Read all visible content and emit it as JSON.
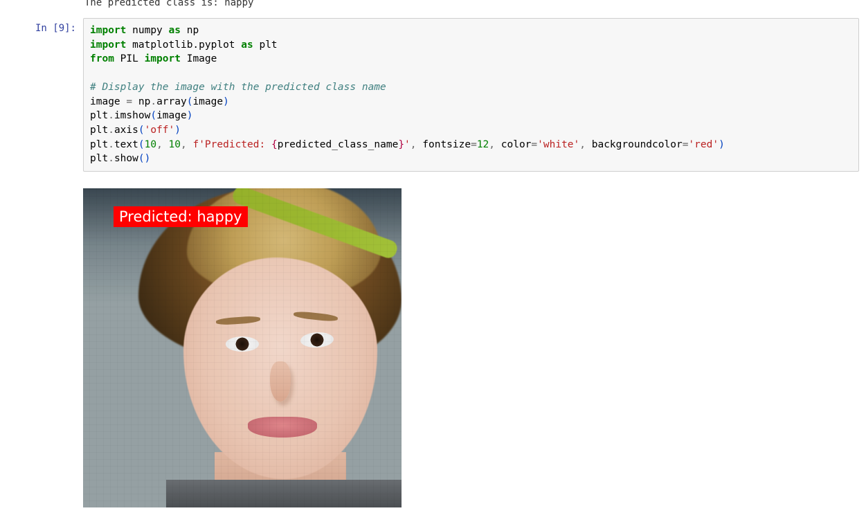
{
  "prev_output": {
    "text": "The predicted class is: happy"
  },
  "cell": {
    "prompt_label": "In [9]:"
  },
  "code": {
    "line1_import": "import",
    "line1_np": "numpy",
    "line1_as": "as",
    "line1_alias": "np",
    "line2_import": "import",
    "line2_mpl": "matplotlib.pyplot",
    "line2_as": "as",
    "line2_alias": "plt",
    "line3_from": "from",
    "line3_pil": "PIL",
    "line3_import": "import",
    "line3_image": "Image",
    "comment": "# Display the image with the predicted class name",
    "l5_lhs": "image",
    "l5_np": " np",
    "l5_dot": ".",
    "l5_array": "array",
    "l5_arg": "image",
    "l6_plt": "plt",
    "l6_imshow": "imshow",
    "l6_arg": "image",
    "l7_plt": "plt",
    "l7_axis": "axis",
    "l7_off": "'off'",
    "l8_plt": "plt",
    "l8_text": "text",
    "l8_n1": "10",
    "l8_n2": "10",
    "l8_fpre": "f'Predicted: ",
    "l8_si_open": "{",
    "l8_var": "predicted_class_name",
    "l8_si_close": "}",
    "l8_fsuf": "'",
    "l8_fontsize_k": "fontsize",
    "l8_fontsize_v": "12",
    "l8_color_k": "color",
    "l8_color_v": "'white'",
    "l8_bg_k": "backgroundcolor",
    "l8_bg_v": "'red'",
    "l9_plt": "plt",
    "l9_show": "show"
  },
  "output_image": {
    "label_text": "Predicted: happy"
  }
}
